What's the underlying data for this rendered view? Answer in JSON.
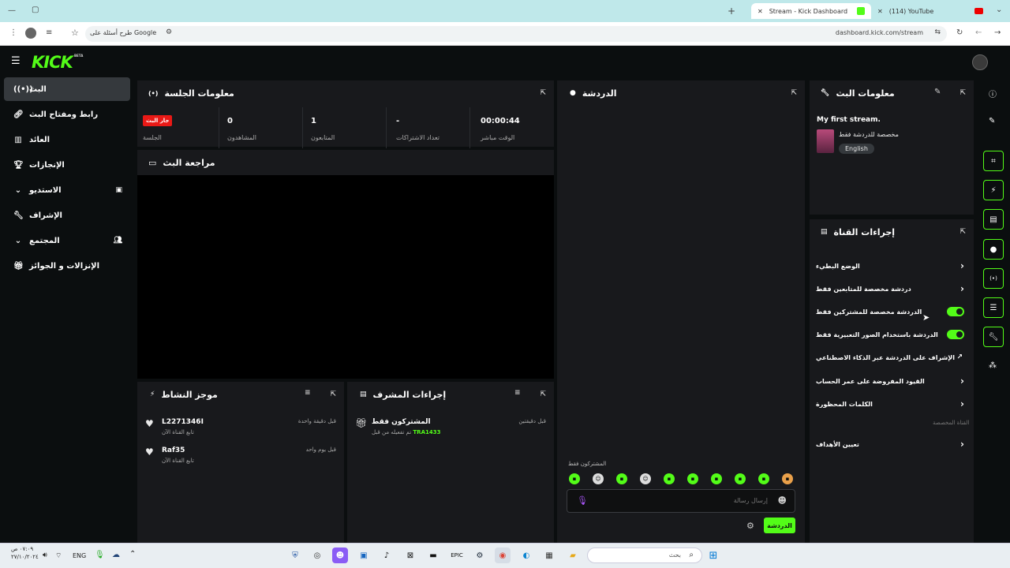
{
  "browser": {
    "tabs": [
      {
        "label": "(114) YouTube"
      },
      {
        "label": "Stream - Kick Dashboard"
      }
    ],
    "address": "dashboard.kick.com/stream",
    "search_chip": "طرح أسئلة على Google"
  },
  "header": {
    "logo": "KICK",
    "beta": "BETA"
  },
  "sidebar": {
    "items": [
      {
        "label": "البث",
        "icon": "broadcast-icon"
      },
      {
        "label": "رابط ومفتاح البث",
        "icon": "link-icon"
      },
      {
        "label": "العائد",
        "icon": "chart-icon"
      },
      {
        "label": "الإنجازات",
        "icon": "trophy-icon"
      },
      {
        "label": "الاستديو",
        "icon": "chevron-down-icon"
      },
      {
        "label": "الإشراف",
        "icon": "wrench-icon"
      },
      {
        "label": "المجتمع",
        "icon": "chevron-down-icon"
      },
      {
        "label": "الإنزالات و الجوائز",
        "icon": "gift-icon"
      }
    ]
  },
  "session": {
    "title": "معلومات الجلسة",
    "live_badge": "جار البث",
    "session_label": "الجلسة",
    "stats": [
      {
        "value": "0",
        "label": "المشاهدون"
      },
      {
        "value": "1",
        "label": "المتابعون"
      },
      {
        "value": "-",
        "label": "تعداد الاشتراكات"
      },
      {
        "value": "00:00:44",
        "label": "الوقت مباشر"
      }
    ]
  },
  "preview": {
    "title": "مراجعة البث"
  },
  "activity": {
    "title": "موجز النشاط",
    "rows": [
      {
        "name": "L2271346I",
        "sub": "تابع القناة الآن",
        "time": "قبل دقيقة واحدة"
      },
      {
        "name": "Raf35",
        "sub": "تابع القناة الآن",
        "time": "قبل يوم واحد"
      }
    ]
  },
  "moderator": {
    "title": "إجراءات المشرف",
    "rows": [
      {
        "name": "المشتركون فقط",
        "sub": "تم تفعيله من قبل",
        "user": "TRA1433",
        "time": "قبل دقيقتين"
      }
    ]
  },
  "chat": {
    "title": "الدردشة",
    "subscribers_only": "المشتركون فقط",
    "placeholder": "إرسال رسالة",
    "send": "الدردشة"
  },
  "stream_info": {
    "title": "معلومات البث",
    "stream_title": "My first stream.",
    "category": "مخصصة للدردشة فقط",
    "language": "English"
  },
  "channel_actions": {
    "title": "إجراءات القناة",
    "items": [
      {
        "label": "الوضع البطيء",
        "type": "chevron"
      },
      {
        "label": "دردشة مخصصة للمتابعين فقط",
        "type": "chevron"
      },
      {
        "label": "الدردشة مخصصة للمشتركين فقط",
        "type": "toggle"
      },
      {
        "label": "الدردشة باستخدام الصور التعبيرية فقط",
        "type": "toggle"
      },
      {
        "label": "الإشراف على الدردشة عبر الذكاء الاصطناعي",
        "type": "external"
      },
      {
        "label": "القيود المفروضة على عمر الحساب",
        "type": "chevron"
      },
      {
        "label": "الكلمات المحظورة",
        "type": "chevron"
      }
    ],
    "section_label": "القناة المخصصة",
    "goals": "تعيين الأهداف"
  },
  "taskbar": {
    "search": "بحث",
    "lang": "ENG",
    "time": "٠٧:٠٩ ص",
    "date": "٢٧/١٠/٢٠٢٤"
  },
  "colors": {
    "accent": "#53fc18",
    "live": "#e91916",
    "panel": "#18191c",
    "bg": "#0b0e0f"
  }
}
